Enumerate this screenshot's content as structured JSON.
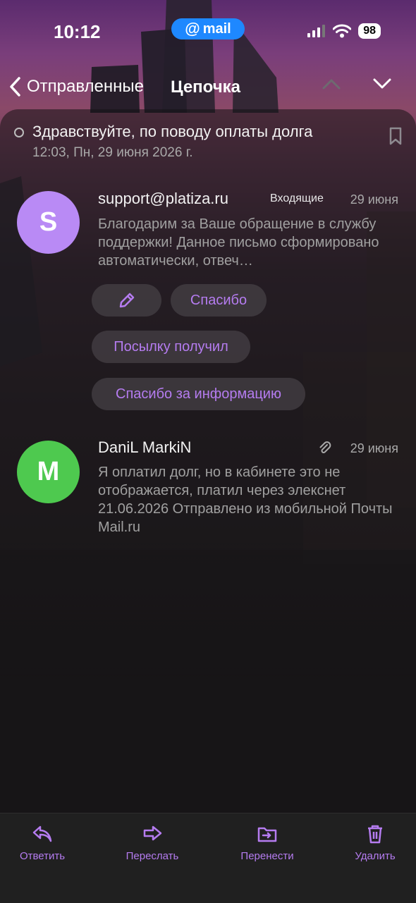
{
  "status_bar": {
    "time": "10:12",
    "app_pill": "mail",
    "battery": "98"
  },
  "nav": {
    "back_label": "Отправленные",
    "title": "Цепочка"
  },
  "thread": {
    "subject": "Здравствуйте, по поводу оплаты долга",
    "date": "12:03, Пн, 29 июня 2026 г."
  },
  "messages": [
    {
      "avatar_letter": "S",
      "avatar_color": "#b98af5",
      "sender": "support@platiza.ru",
      "folder": "Входящие",
      "date": "29 июня",
      "preview": "Благодарим за Ваше обращение в службу поддержки! Данное письмо сформировано автоматически, отвеч…"
    },
    {
      "avatar_letter": "M",
      "avatar_color": "#4ec94f",
      "sender": "DaniL MarkiN",
      "date": "29 июня",
      "preview": "Я оплатил долг, но в кабинете это не отображается, платил через элекснет 21.06.2026 Отправлено из мобильной Почты Mail.ru"
    }
  ],
  "quick_replies": [
    "Спасибо",
    "Посылку получил",
    "Спасибо за информацию"
  ],
  "toolbar": {
    "reply": "Ответить",
    "forward": "Переслать",
    "move": "Перенести",
    "delete": "Удалить"
  },
  "colors": {
    "accent": "#b57cf0",
    "pill": "#1e88ff"
  }
}
